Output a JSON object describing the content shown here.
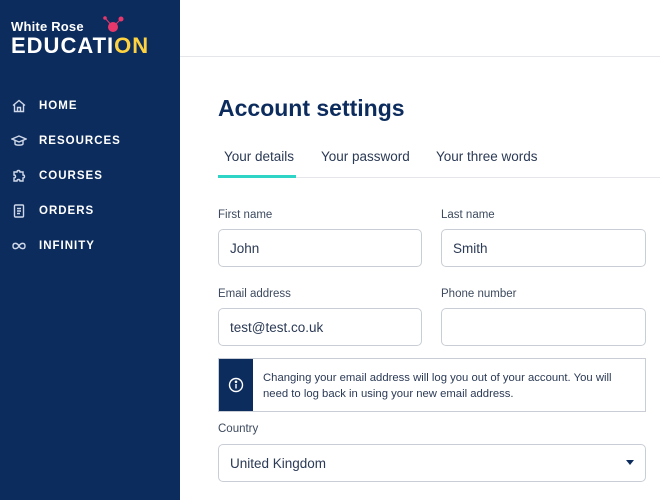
{
  "brand": {
    "line1": "White Rose",
    "line2_main": "EDUCATI",
    "line2_accent": "ON",
    "colors": {
      "navy": "#0d2c5e",
      "teal": "#2ed4c6",
      "yellow": "#ffd23f",
      "pink": "#e8386b"
    }
  },
  "sidebar": {
    "items": [
      {
        "label": "HOME",
        "icon": "home-icon"
      },
      {
        "label": "RESOURCES",
        "icon": "graduation-cap-icon"
      },
      {
        "label": "COURSES",
        "icon": "puzzle-icon"
      },
      {
        "label": "ORDERS",
        "icon": "document-icon"
      },
      {
        "label": "INFINITY",
        "icon": "infinity-icon"
      }
    ]
  },
  "page": {
    "title": "Account settings"
  },
  "tabs": [
    {
      "label": "Your details",
      "active": true
    },
    {
      "label": "Your password",
      "active": false
    },
    {
      "label": "Your three words",
      "active": false
    }
  ],
  "form": {
    "first_name": {
      "label": "First name",
      "value": "John"
    },
    "last_name": {
      "label": "Last name",
      "value": "Smith"
    },
    "email": {
      "label": "Email address",
      "value": "test@test.co.uk"
    },
    "phone": {
      "label": "Phone number",
      "value": ""
    },
    "notice": {
      "icon": "info-icon",
      "text": "Changing your email address will log you out of your account. You will need to log back in using your new email address."
    },
    "country": {
      "label": "Country",
      "value": "United Kingdom"
    }
  }
}
